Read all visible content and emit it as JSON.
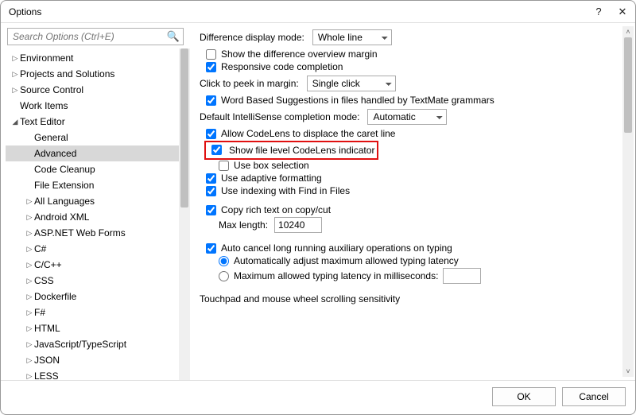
{
  "title": "Options",
  "search_placeholder": "Search Options (Ctrl+E)",
  "tree": [
    {
      "label": "Environment",
      "level": 1,
      "caret": "▷",
      "sel": false
    },
    {
      "label": "Projects and Solutions",
      "level": 1,
      "caret": "▷",
      "sel": false
    },
    {
      "label": "Source Control",
      "level": 1,
      "caret": "▷",
      "sel": false
    },
    {
      "label": "Work Items",
      "level": 1,
      "caret": "",
      "sel": false
    },
    {
      "label": "Text Editor",
      "level": 1,
      "caret": "◢",
      "sel": false
    },
    {
      "label": "General",
      "level": 2,
      "caret": "",
      "sel": false
    },
    {
      "label": "Advanced",
      "level": 2,
      "caret": "",
      "sel": true
    },
    {
      "label": "Code Cleanup",
      "level": 2,
      "caret": "",
      "sel": false
    },
    {
      "label": "File Extension",
      "level": 2,
      "caret": "",
      "sel": false
    },
    {
      "label": "All Languages",
      "level": 2,
      "caret": "▷",
      "sel": false
    },
    {
      "label": "Android XML",
      "level": 2,
      "caret": "▷",
      "sel": false
    },
    {
      "label": "ASP.NET Web Forms",
      "level": 2,
      "caret": "▷",
      "sel": false
    },
    {
      "label": "C#",
      "level": 2,
      "caret": "▷",
      "sel": false
    },
    {
      "label": "C/C++",
      "level": 2,
      "caret": "▷",
      "sel": false
    },
    {
      "label": "CSS",
      "level": 2,
      "caret": "▷",
      "sel": false
    },
    {
      "label": "Dockerfile",
      "level": 2,
      "caret": "▷",
      "sel": false
    },
    {
      "label": "F#",
      "level": 2,
      "caret": "▷",
      "sel": false
    },
    {
      "label": "HTML",
      "level": 2,
      "caret": "▷",
      "sel": false
    },
    {
      "label": "JavaScript/TypeScript",
      "level": 2,
      "caret": "▷",
      "sel": false
    },
    {
      "label": "JSON",
      "level": 2,
      "caret": "▷",
      "sel": false
    },
    {
      "label": "LESS",
      "level": 2,
      "caret": "▷",
      "sel": false
    }
  ],
  "pane": {
    "diff_mode_label": "Difference display mode:",
    "diff_mode_value": "Whole line",
    "show_overview": "Show the difference overview margin",
    "responsive_cc": "Responsive code completion",
    "peek_label": "Click to peek in margin:",
    "peek_value": "Single click",
    "word_based": "Word Based Suggestions in files handled by TextMate grammars",
    "intellisense_label": "Default IntelliSense completion mode:",
    "intellisense_value": "Automatic",
    "allow_codelens": "Allow CodeLens to displace the caret line",
    "show_file_level": "Show file level CodeLens indicator",
    "use_box": "Use box selection",
    "use_adaptive": "Use adaptive formatting",
    "use_indexing": "Use indexing with Find in Files",
    "copy_rich": "Copy rich text on copy/cut",
    "max_length_label": "Max length:",
    "max_length_value": "10240",
    "auto_cancel": "Auto cancel long running auxiliary operations on typing",
    "auto_adjust": "Automatically adjust maximum allowed typing latency",
    "max_latency": "Maximum allowed typing latency in milliseconds:",
    "touchpad": "Touchpad and mouse wheel scrolling sensitivity"
  },
  "buttons": {
    "ok": "OK",
    "cancel": "Cancel"
  }
}
